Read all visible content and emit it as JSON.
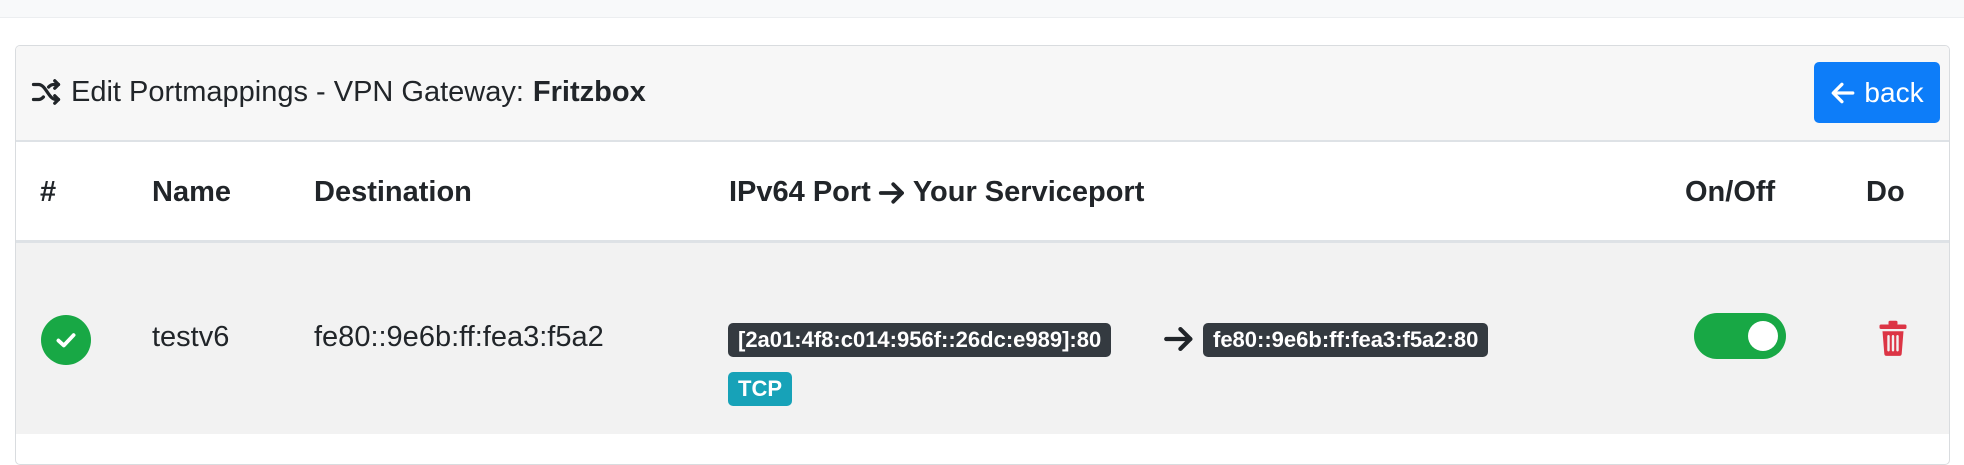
{
  "header": {
    "title_prefix": "Edit Portmappings - VPN Gateway:",
    "gateway_name": "Fritzbox",
    "back_label": "back",
    "title_icon": "shuffle-icon"
  },
  "table": {
    "columns": {
      "index": "#",
      "name": "Name",
      "destination": "Destination",
      "ports_left": "IPv64 Port",
      "ports_right": "Your Serviceport",
      "onoff": "On/Off",
      "do": "Do"
    },
    "rows": [
      {
        "status_icon": "check-circle-icon",
        "name": "testv6",
        "destination": "fe80::9e6b:ff:fea3:f5a2",
        "ipv64_port": "[2a01:4f8:c014:956f::26dc:e989]:80",
        "service_port": "fe80::9e6b:ff:fea3:f5a2:80",
        "protocol": "TCP",
        "enabled": true,
        "action_icon": "trash-icon"
      }
    ]
  },
  "colors": {
    "primary": "#0d7df9",
    "success": "#18a845",
    "danger": "#dc3545",
    "dark_badge": "#343a40",
    "info_badge": "#17a2b8"
  }
}
